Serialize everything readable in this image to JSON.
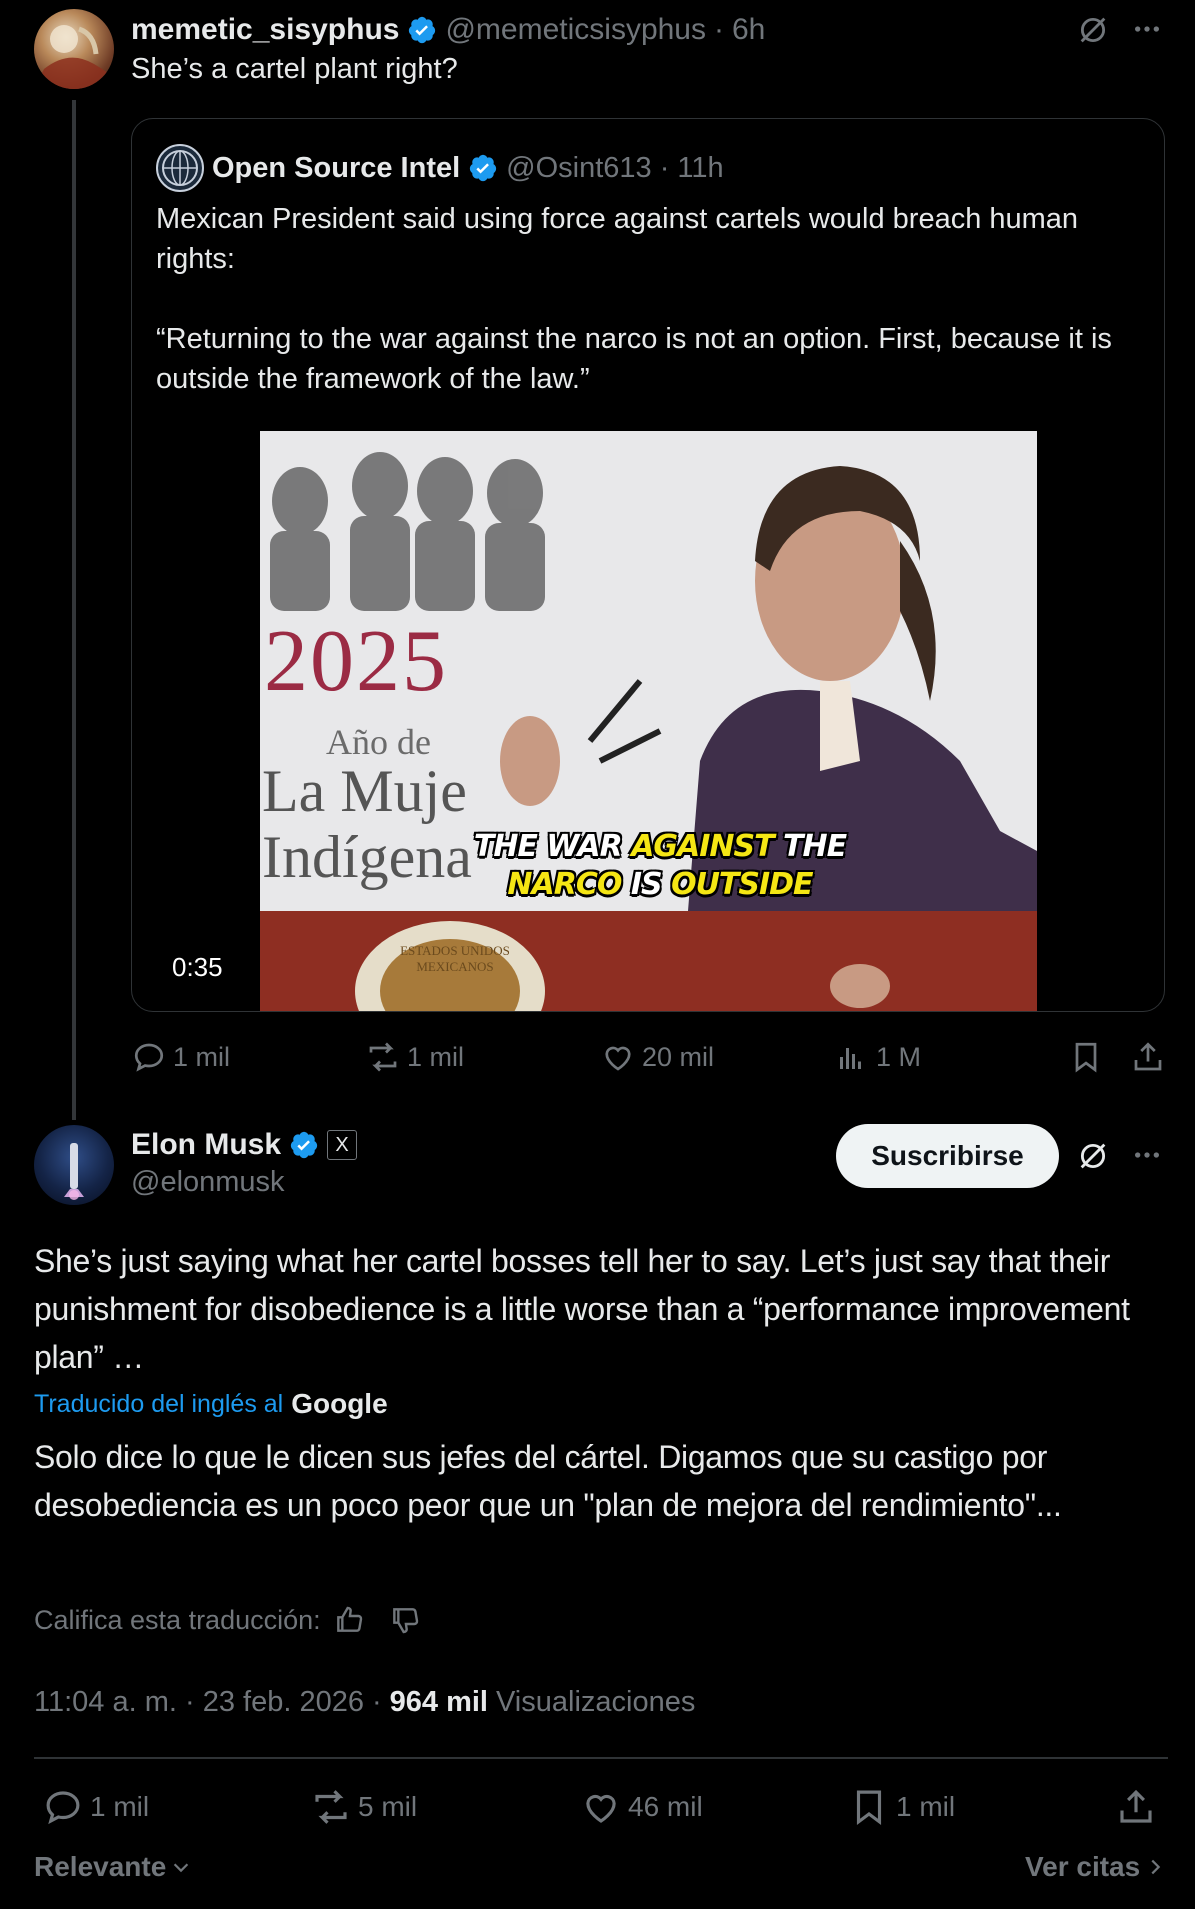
{
  "reply": {
    "display_name": "memetic_sisyphus",
    "handle": "@memeticsisyphus",
    "dot": "·",
    "time": "6h",
    "text": "She’s a cartel plant right?"
  },
  "quote": {
    "display_name": "Open Source Intel",
    "handle": "@Osint613",
    "dot": "·",
    "time": "11h",
    "text_1": "Mexican President said using force against cartels would breach human rights:",
    "text_2": "“Returning to the war against the narco is not an option. First, because it is outside the framework of the law.”",
    "video": {
      "duration": "0:35",
      "banner_year": "2025",
      "banner_line1": "Año de",
      "banner_line2": "La Muje",
      "banner_line3": "Indígena",
      "seal_text": "ESTADOS UNIDOS MEXICANOS",
      "caption_words": [
        "THE",
        "WAR",
        "AGAINST",
        "THE",
        "NARCO",
        "IS",
        "OUTSIDE"
      ]
    }
  },
  "reply_actions": {
    "replies": "1 mil",
    "reposts": "1 mil",
    "likes": "20 mil",
    "views": "1 M"
  },
  "main": {
    "display_name": "Elon Musk",
    "affiliate_badge": "X",
    "handle": "@elonmusk",
    "subscribe_label": "Suscribirse",
    "text": "She’s just saying what her cartel bosses tell her to say. Let’s just say that their punishment for disobedience is a little worse than a “performance improvement plan” …",
    "translated_label": "Traducido del inglés al",
    "translated_brand": "Google",
    "translation": "Solo dice lo que le dicen sus jefes del cártel. Digamos que su castigo por desobediencia es un poco peor que un \"plan de mejora del rendimiento\"...",
    "rate_label": "Califica esta traducción:",
    "timestamp": "11:04 a. m. · 23 feb. 2026",
    "dot": "·",
    "views_count": "964 mil",
    "views_label": "Visualizaciones"
  },
  "main_actions": {
    "replies": "1 mil",
    "reposts": "5 mil",
    "likes": "46 mil",
    "bookmarks": "1 mil"
  },
  "footer": {
    "sort_label": "Relevante",
    "quotes_label": "Ver citas"
  },
  "colors": {
    "accent": "#1d9bf0",
    "verified": "#1d9bf0",
    "muted": "#71767b",
    "caption_yellow": "#f5e614"
  }
}
